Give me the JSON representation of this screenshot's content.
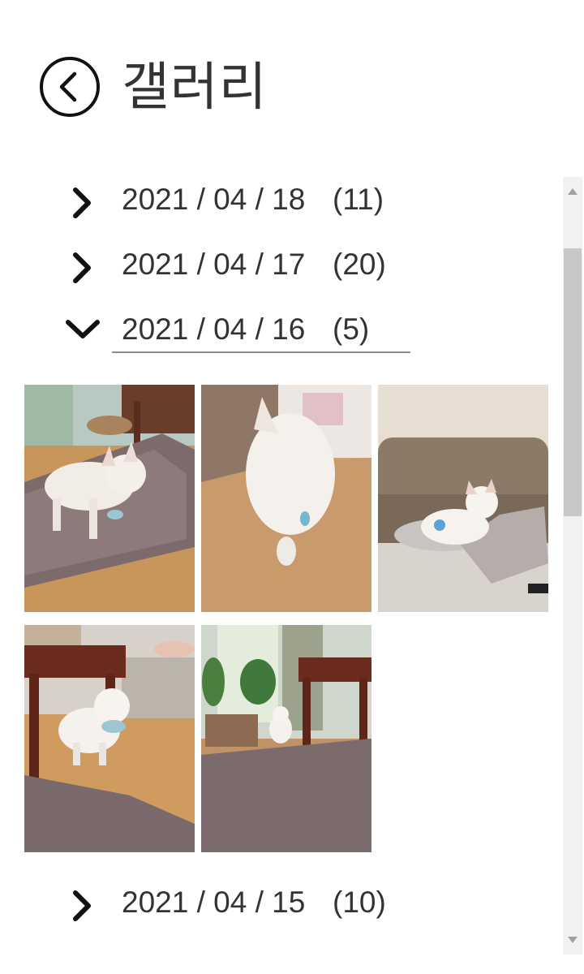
{
  "header": {
    "title": "갤러리",
    "back_icon": "chevron-left-circle-icon"
  },
  "groups": [
    {
      "date": "2021 / 04 / 18",
      "count": "(11)",
      "expanded": false
    },
    {
      "date": "2021 / 04 / 17",
      "count": "(20)",
      "expanded": false
    },
    {
      "date": "2021 / 04 / 16",
      "count": "(5)",
      "expanded": true,
      "photos": [
        "white-dog-on-rug-photo",
        "blurry-white-dog-photo",
        "white-dog-on-sofa-photo",
        "white-dog-under-table-photo",
        "white-dog-in-living-room-photo"
      ]
    },
    {
      "date": "2021 / 04 / 15",
      "count": "(10)",
      "expanded": false
    }
  ],
  "colors": {
    "text": "#333333",
    "icon": "#111111",
    "scrollbar_track": "#f1f1f1",
    "scrollbar_thumb": "#c8c8c8"
  }
}
